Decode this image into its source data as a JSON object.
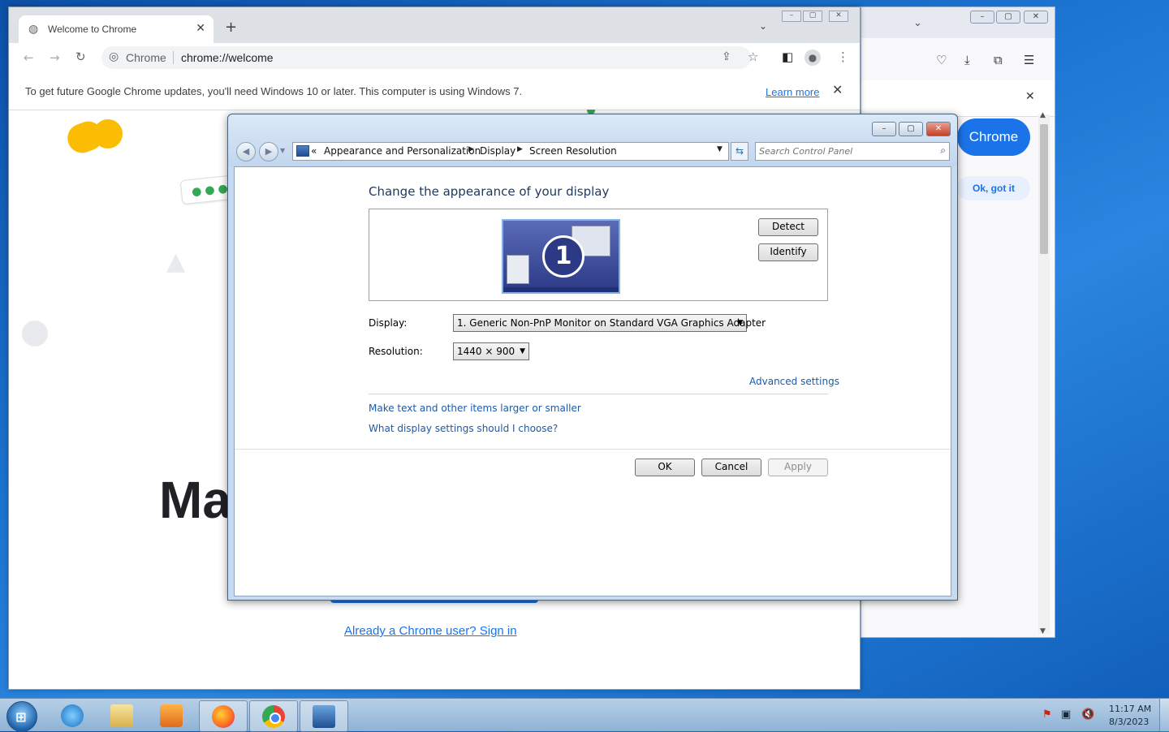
{
  "firefox": {
    "chrome_button": "Chrome",
    "ok_button": "Ok, got it"
  },
  "chrome": {
    "tab_title": "Welcome to Chrome",
    "omnibox_chip": "Chrome",
    "url": "chrome://welcome",
    "infobar_message": "To get future Google Chrome updates, you'll need Windows 10 or later. This computer is using Windows 7.",
    "infobar_link": "Learn more",
    "heading_partial": "Ma",
    "signin_link": "Already a Chrome user? Sign in"
  },
  "control_panel": {
    "breadcrumb": [
      "Appearance and Personalization",
      "Display",
      "Screen Resolution"
    ],
    "search_placeholder": "Search Control Panel",
    "heading": "Change the appearance of your display",
    "monitor_number": "1",
    "detect_button": "Detect",
    "identify_button": "Identify",
    "display_label": "Display:",
    "display_value": "1. Generic Non-PnP Monitor on Standard VGA Graphics Adapter",
    "resolution_label": "Resolution:",
    "resolution_value": "1440 × 900",
    "advanced_settings": "Advanced settings",
    "link_text_size": "Make text and other items larger or smaller",
    "link_help": "What display settings should I choose?",
    "ok_button": "OK",
    "cancel_button": "Cancel",
    "apply_button": "Apply"
  },
  "taskbar": {
    "time": "11:17 AM",
    "date": "8/3/2023"
  },
  "colors": {
    "chrome_blue": "#1a73e8",
    "cp_heading": "#1e395b",
    "cp_link": "#1c5aa8"
  }
}
